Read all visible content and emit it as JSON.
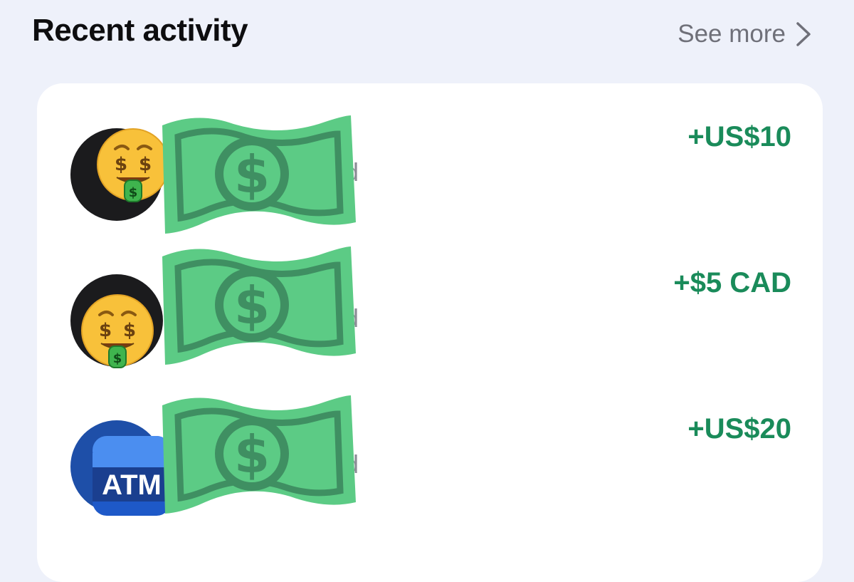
{
  "header": {
    "title": "Recent activity",
    "see_more_label": "See more"
  },
  "activity": [
    {
      "amount": "+US$10",
      "avatar_icon": "money-mouth-face-icon",
      "partial_text": "d"
    },
    {
      "amount": "+$5 CAD",
      "avatar_icon": "money-mouth-face-icon",
      "partial_text": "d"
    },
    {
      "amount": "+US$20",
      "avatar_icon": "atm-sign-icon",
      "avatar_badge_text": "ATM",
      "partial_text": "d"
    }
  ],
  "colors": {
    "background": "#eef1fa",
    "card": "#ffffff",
    "amount_green": "#1a8b5a",
    "money_sticker": "#5ccb85",
    "money_sticker_dark": "#3f8f62",
    "atm_blue": "#1e59c8"
  }
}
